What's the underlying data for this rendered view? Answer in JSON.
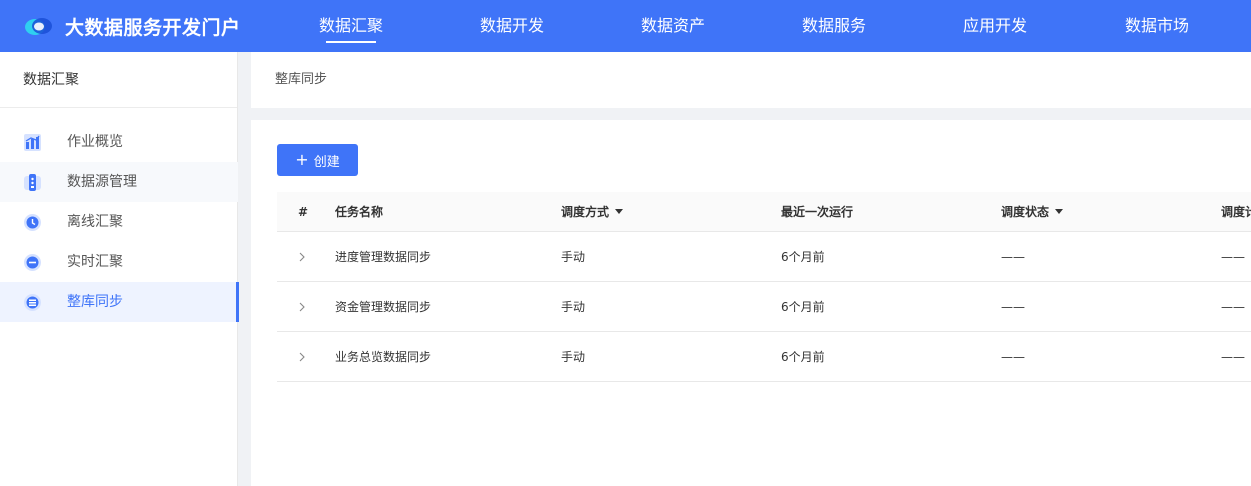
{
  "app": {
    "title": "大数据服务开发门户"
  },
  "nav": [
    {
      "label": "数据汇聚",
      "active": true
    },
    {
      "label": "数据开发"
    },
    {
      "label": "数据资产"
    },
    {
      "label": "数据服务"
    },
    {
      "label": "应用开发"
    },
    {
      "label": "数据市场"
    }
  ],
  "sidebar": {
    "title": "数据汇聚",
    "items": [
      {
        "label": "作业概览",
        "icon": "chart-icon"
      },
      {
        "label": "数据源管理",
        "icon": "database-icon"
      },
      {
        "label": "离线汇聚",
        "icon": "clock-icon"
      },
      {
        "label": "实时汇聚",
        "icon": "realtime-icon"
      },
      {
        "label": "整库同步",
        "icon": "sync-icon",
        "active": true
      }
    ]
  },
  "breadcrumb": "整库同步",
  "toolbar": {
    "create_label": "创建"
  },
  "table": {
    "columns": [
      "#",
      "任务名称",
      "调度方式",
      "最近一次运行",
      "调度状态",
      "调度计"
    ],
    "rows": [
      {
        "name": "进度管理数据同步",
        "mode": "手动",
        "last_run": "6个月前",
        "status": "——",
        "schedule": "——"
      },
      {
        "name": "资金管理数据同步",
        "mode": "手动",
        "last_run": "6个月前",
        "status": "——",
        "schedule": "——"
      },
      {
        "name": "业务总览数据同步",
        "mode": "手动",
        "last_run": "6个月前",
        "status": "——",
        "schedule": "——"
      }
    ]
  },
  "colors": {
    "primary": "#3f74f8",
    "background": "#f0f2f5"
  }
}
